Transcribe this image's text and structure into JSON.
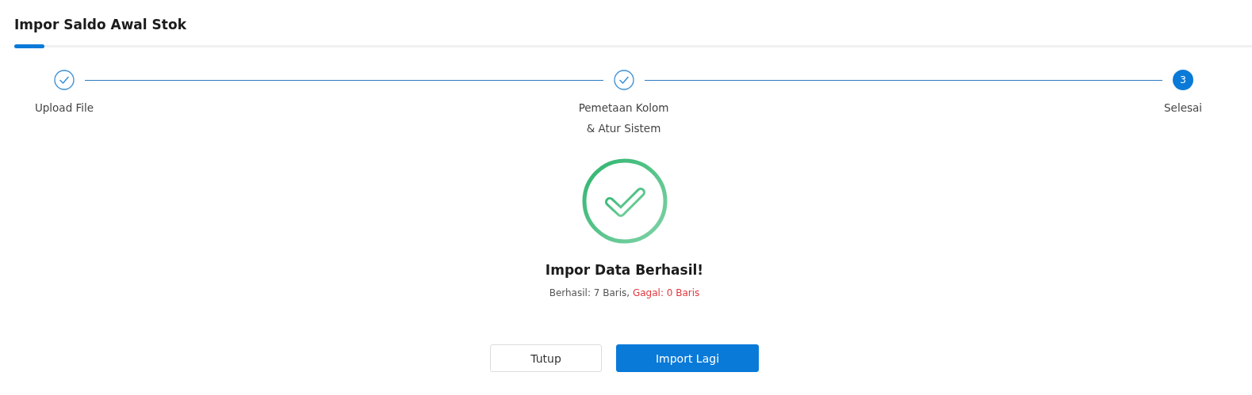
{
  "title": "Impor Saldo Awal Stok",
  "steps": [
    {
      "label": "Upload File",
      "completed": true
    },
    {
      "label": "Pemetaan Kolom\n& Atur Sistem",
      "completed": true
    },
    {
      "number": "3",
      "label": "Selesai",
      "completed": false
    }
  ],
  "result": {
    "heading": "Impor Data Berhasil!",
    "success_text": "Berhasil: 7 Baris,",
    "failed_text": "Gagal: 0 Baris"
  },
  "buttons": [
    {
      "label": "Tutup",
      "kind": "secondary"
    },
    {
      "label": "Import Lagi",
      "kind": "primary"
    }
  ]
}
